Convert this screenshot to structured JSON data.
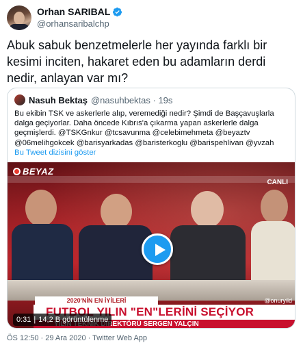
{
  "author": {
    "display_name": "Orhan SARIBAL",
    "handle": "@orhansaribalchp"
  },
  "tweet": {
    "text": "Abuk sabuk benzetmelerle her yayında farklı bir kesimi inciten, hakaret eden bu adamların derdi nedir, anlayan var mı?"
  },
  "quoted_tweet": {
    "display_name": "Nasuh Bektaş",
    "meta": "@nasuhbektas · 19s",
    "text": "Bu ekibin TSK ve askerlerle alıp, veremediği nedir? Şimdi de Başçavuşlarla dalga geçiyorlar. Daha öncede Kıbrıs'a çıkarma yapan askerlerle dalga geçmişlerdi. @TSKGnkur @tcsavunma @celebimehmeta @beyaztv @06melihgokcek @barisyarkadas @baristerkoglu @barispehlivan @yvzah",
    "show_thread": "Bu Tweet dizisini göster"
  },
  "video": {
    "channel": "BEYAZ",
    "live_label": "CANLI",
    "banner_top": "2020'NİN EN İYİLERİ",
    "banner_handle": "@onuryild",
    "banner_main": "FUTBOL YILIN \"EN\"LERİNİ SEÇİYOR",
    "banner_sub": "YILIN TEKNİK DİREKTÖRÜ SERGEN YALÇIN",
    "time": "0:31",
    "views": "14,2 B görüntülenme"
  },
  "footer": {
    "timestamp": "ÖS 12:50 · 29 Ara 2020 · Twitter Web App"
  },
  "colors": {
    "accent": "#1d9bf0",
    "secondary_text": "#536471",
    "border": "#cfd9de"
  },
  "icons": {
    "verified": "verified-badge-icon",
    "play": "play-icon"
  }
}
